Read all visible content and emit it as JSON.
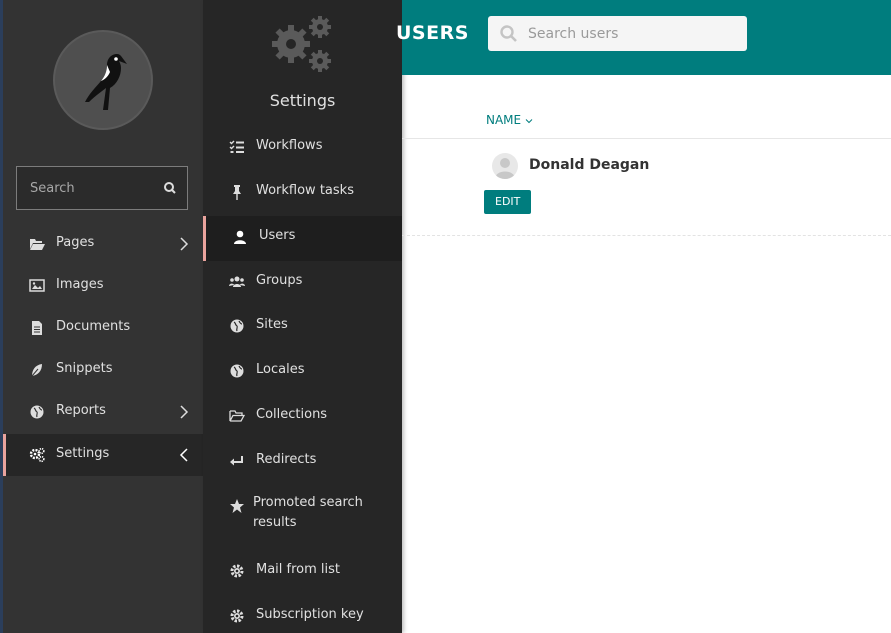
{
  "sidebar": {
    "logo_icon": "wagtail-bird-icon",
    "search_placeholder": "Search",
    "items": [
      {
        "label": "Pages",
        "icon": "folder-open-icon",
        "has_submenu": true
      },
      {
        "label": "Images",
        "icon": "image-icon",
        "has_submenu": false
      },
      {
        "label": "Documents",
        "icon": "doc-full-icon",
        "has_submenu": false
      },
      {
        "label": "Snippets",
        "icon": "snippet-icon",
        "has_submenu": false
      },
      {
        "label": "Reports",
        "icon": "site-icon",
        "has_submenu": true
      },
      {
        "label": "Settings",
        "icon": "cogs-icon",
        "has_submenu": true,
        "active": true
      }
    ]
  },
  "submenu": {
    "title": "Settings",
    "icon": "cogs-icon",
    "items": [
      {
        "label": "Workflows",
        "icon": "tasks-icon"
      },
      {
        "label": "Workflow tasks",
        "icon": "thumbtack-icon"
      },
      {
        "label": "Users",
        "icon": "user-icon",
        "active": true
      },
      {
        "label": "Groups",
        "icon": "group-icon"
      },
      {
        "label": "Sites",
        "icon": "site-icon"
      },
      {
        "label": "Locales",
        "icon": "site-icon"
      },
      {
        "label": "Collections",
        "icon": "folder-open-icon"
      },
      {
        "label": "Redirects",
        "icon": "redirect-icon"
      },
      {
        "label": "Promoted search results",
        "icon": "pick-icon"
      },
      {
        "label": "Mail from list",
        "icon": "cog-icon"
      },
      {
        "label": "Subscription key",
        "icon": "cog-icon"
      }
    ]
  },
  "header": {
    "title": "USERS",
    "search_placeholder": "Search users"
  },
  "listing": {
    "column_name": "NAME",
    "rows": [
      {
        "name": "Donald Deagan",
        "edit_label": "EDIT"
      }
    ]
  },
  "colors": {
    "accent": "#007d7e",
    "sidebar_bg": "#333333",
    "submenu_bg": "#262626",
    "active_marker": "#e9a39d"
  }
}
